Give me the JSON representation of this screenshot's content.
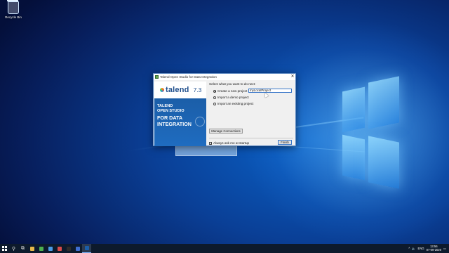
{
  "desktop": {
    "recycle_bin_label": "Recycle Bin"
  },
  "dialog": {
    "title": "Talend Open Studio for Data Integration",
    "close_symbol": "✕",
    "banner": {
      "logo_text": "talend",
      "version": "7.3",
      "line1": "TALEND",
      "line2": "OPEN STUDIO",
      "line3": "FOR DATA",
      "line4": "INTEGRATION"
    },
    "prompt": "Select what you want to do next:",
    "options": [
      {
        "label": "Create a new project",
        "selected": true
      },
      {
        "label": "Import a demo project",
        "selected": false
      },
      {
        "label": "Import an existing project",
        "selected": false
      }
    ],
    "project_name_value": "myLocalProject",
    "manage_connections_label": "Manage Connections",
    "always_ask_label": "Always ask me at startup",
    "always_ask_checked": true,
    "check_mark": "✓",
    "finish_label": "Finish"
  },
  "taskbar": {
    "search_glyph": "⚲",
    "task_view_glyph": "⧉",
    "apps": [
      {
        "name": "file-explorer-icon",
        "color": "#e6b84a"
      },
      {
        "name": "chrome-icon",
        "color": "#4caf50"
      },
      {
        "name": "mail-icon",
        "color": "#4a9be6"
      },
      {
        "name": "photos-icon",
        "color": "#d84b4b"
      },
      {
        "name": "terminal-icon",
        "color": "#2b2b2b"
      },
      {
        "name": "store-icon",
        "color": "#3f6fd1"
      },
      {
        "name": "talend-icon",
        "color": "#1b5ea8"
      }
    ],
    "tray": {
      "chevron": "^",
      "volume": "🔈",
      "language": "ENG",
      "time": "13:56",
      "date": "07-09-2020",
      "notification": "▭"
    }
  }
}
